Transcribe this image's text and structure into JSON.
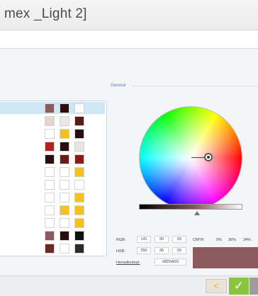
{
  "window": {
    "title": "mex _Light 2]"
  },
  "general_group": {
    "label": "General"
  },
  "swatches": {
    "rows": [
      {
        "selected": true,
        "colors": [
          "#8c5a5e",
          "#2a0d0f",
          "#ffffff"
        ]
      },
      {
        "selected": false,
        "colors": [
          "#e6d5cf",
          "#e8e8e8",
          "#5a1b16"
        ]
      },
      {
        "selected": false,
        "colors": [
          "#ffffff",
          "#f4c21b",
          "#2a0d0f"
        ]
      },
      {
        "selected": false,
        "colors": [
          "#b71d21",
          "#2a0d0f",
          "#e8e6e3"
        ]
      },
      {
        "selected": false,
        "colors": [
          "#2a0d0f",
          "#6a1b17",
          "#8a1b14"
        ]
      },
      {
        "selected": false,
        "colors": [
          "#ffffff",
          "#ffffff",
          "#f4c21b"
        ]
      },
      {
        "selected": false,
        "colors": [
          "#ffffff",
          "#ffffff",
          "#ffffff"
        ]
      },
      {
        "selected": false,
        "colors": [
          "#ffffff",
          "#ffffff",
          "#f4c21b"
        ]
      },
      {
        "selected": false,
        "colors": [
          "#ffffff",
          "#f4c21b",
          "#f4c21b"
        ]
      },
      {
        "selected": false,
        "colors": [
          "#ffffff",
          "#ffffff",
          "#f4c21b"
        ]
      },
      {
        "selected": false,
        "colors": [
          "#8c5a5e",
          "#2a0d0f",
          "#111111"
        ]
      },
      {
        "selected": false,
        "colors": [
          "#6a2a23",
          "#ffffff",
          "#2b2b2b"
        ]
      }
    ]
  },
  "color_values": {
    "rgb_label": "RGB:",
    "r": "141",
    "g": "90",
    "b": "93",
    "cmyk_label": "CMYK",
    "c": "0%",
    "m": "36%",
    "y": "34%",
    "hsb_label": "HSB:",
    "h": "356",
    "s": "36",
    "v": "55",
    "hex_label": "Hexadecimal:",
    "hex": "#8D5A5D"
  },
  "preview_color": "#8d5a5d",
  "footer": {
    "back_icon": "<",
    "ok_icon": "✓"
  }
}
